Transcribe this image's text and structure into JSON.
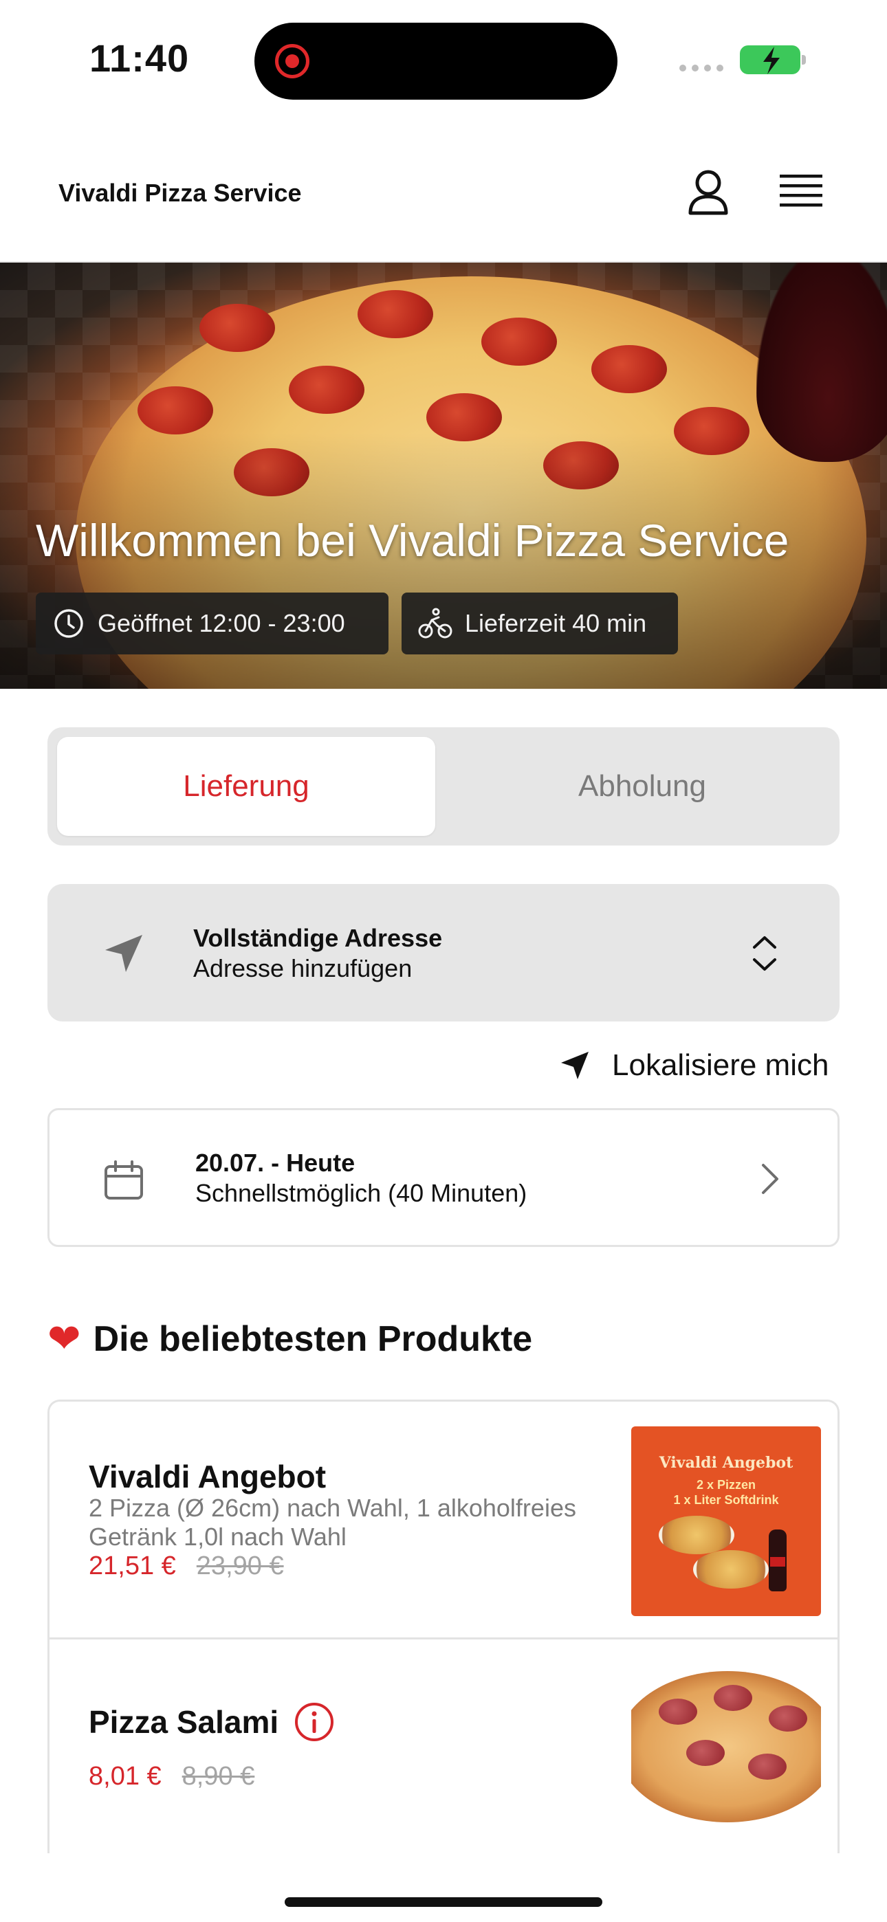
{
  "status_bar": {
    "time": "11:40"
  },
  "header": {
    "brand": "Vivaldi Pizza Service",
    "icons": [
      "user-icon",
      "hamburger-menu-icon"
    ]
  },
  "hero": {
    "title": "Willkommen bei Vivaldi Pizza Service",
    "opening_hours": "Geöffnet 12:00 - 23:00",
    "delivery_time": "Lieferzeit 40 min"
  },
  "order_mode": {
    "options": [
      "Lieferung",
      "Abholung"
    ],
    "selected": "Lieferung"
  },
  "address": {
    "title": "Vollständige Adresse",
    "subtitle": "Adresse hinzufügen"
  },
  "locate": {
    "label": "Lokalisiere mich"
  },
  "schedule": {
    "title": "20.07. - Heute",
    "subtitle": "Schnellstmöglich (40 Minuten)"
  },
  "popular": {
    "heading": "Die beliebtesten Produkte",
    "products": [
      {
        "name": "Vivaldi Angebot",
        "description": "2 Pizza (Ø 26cm) nach Wahl, 1 alkoholfreies Getränk 1,0l nach Wahl",
        "price": "21,51 €",
        "old_price": "23,90 €",
        "image_text_1": "Vivaldi Angebot",
        "image_text_2": "2 x Pizzen",
        "image_text_3": "1 x Liter Softdrink"
      },
      {
        "name": "Pizza Salami",
        "price": "8,01 €",
        "old_price": "8,90 €"
      }
    ]
  },
  "colors": {
    "accent_red": "#d6262b",
    "segment_bg": "#e6e6e6",
    "chip_bg": "#1e1e1e"
  }
}
